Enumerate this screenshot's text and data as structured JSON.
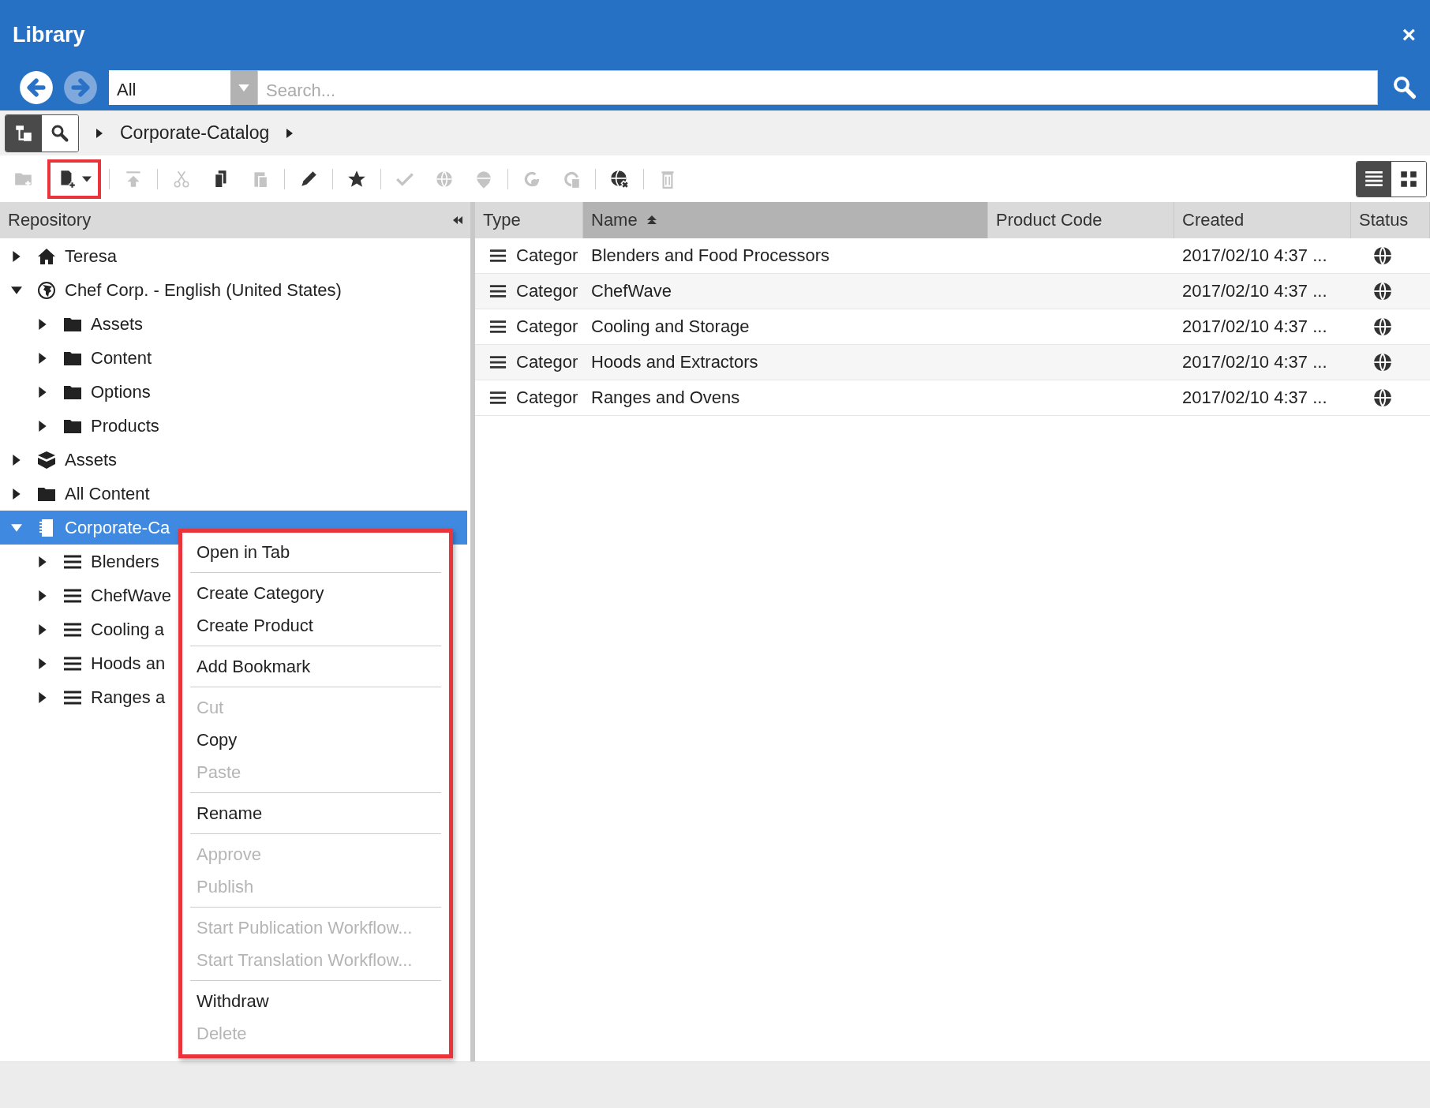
{
  "window": {
    "title": "Library",
    "close": "×"
  },
  "search": {
    "scope": "All",
    "placeholder": "Search..."
  },
  "view_switch": [
    {
      "kind": "tree",
      "selected": true
    },
    {
      "kind": "search",
      "selected": false
    }
  ],
  "breadcrumb": [
    "Corporate-Catalog"
  ],
  "toolbar": [
    {
      "disabled": true,
      "highlighted": false
    },
    {
      "disabled": false,
      "highlighted": true
    },
    {
      "disabled": true,
      "highlighted": false
    },
    {
      "disabled": true,
      "highlighted": false
    },
    {
      "disabled": false,
      "highlighted": false
    },
    {
      "disabled": true,
      "highlighted": false
    },
    {
      "disabled": false,
      "highlighted": false
    },
    {
      "disabled": false,
      "highlighted": false
    },
    {
      "disabled": true,
      "highlighted": false
    },
    {
      "disabled": true,
      "highlighted": false
    },
    {
      "disabled": true,
      "highlighted": false
    },
    {
      "disabled": true,
      "highlighted": false
    },
    {
      "disabled": true,
      "highlighted": false
    },
    {
      "disabled": false,
      "highlighted": false
    },
    {
      "disabled": true,
      "highlighted": false
    }
  ],
  "layout_toggle": [
    {
      "kind": "list",
      "selected": true
    },
    {
      "kind": "grid",
      "selected": false
    }
  ],
  "sidebar": {
    "title": "Repository",
    "items": [
      {
        "label": "Teresa",
        "kind": "home",
        "expanded": false,
        "selected": false
      },
      {
        "label": "Chef Corp. - English (United States)",
        "kind": "site",
        "expanded": true,
        "selected": false,
        "children": [
          {
            "label": "Assets",
            "kind": "folder",
            "expanded": false,
            "selected": false
          },
          {
            "label": "Content",
            "kind": "folder",
            "expanded": false,
            "selected": false
          },
          {
            "label": "Options",
            "kind": "folder",
            "expanded": false,
            "selected": false
          },
          {
            "label": "Products",
            "kind": "folder",
            "expanded": false,
            "selected": false
          }
        ]
      },
      {
        "label": "Assets",
        "kind": "assets",
        "expanded": false,
        "selected": false
      },
      {
        "label": "All Content",
        "kind": "folder",
        "expanded": false,
        "selected": false
      },
      {
        "label": "Corporate-Ca",
        "kind": "catalog",
        "expanded": true,
        "selected": true,
        "children": [
          {
            "label": "Blenders",
            "kind": "category",
            "expanded": false,
            "selected": false
          },
          {
            "label": "ChefWave",
            "kind": "category",
            "expanded": false,
            "selected": false
          },
          {
            "label": "Cooling a",
            "kind": "category",
            "expanded": false,
            "selected": false
          },
          {
            "label": "Hoods an",
            "kind": "category",
            "expanded": false,
            "selected": false
          },
          {
            "label": "Ranges a",
            "kind": "category",
            "expanded": false,
            "selected": false
          }
        ]
      }
    ]
  },
  "table": {
    "columns": [
      {
        "label": "Type",
        "sorted": false
      },
      {
        "label": "Name",
        "sorted": true
      },
      {
        "label": "Product Code",
        "sorted": false
      },
      {
        "label": "Created",
        "sorted": false
      },
      {
        "label": "Status",
        "sorted": false
      }
    ],
    "rows": [
      {
        "type": "Categor",
        "name": "Blenders and Food Processors",
        "product_code": "",
        "created": "2017/02/10 4:37 ..."
      },
      {
        "type": "Categor",
        "name": "ChefWave",
        "product_code": "",
        "created": "2017/02/10 4:37 ..."
      },
      {
        "type": "Categor",
        "name": "Cooling and Storage",
        "product_code": "",
        "created": "2017/02/10 4:37 ..."
      },
      {
        "type": "Categor",
        "name": "Hoods and Extractors",
        "product_code": "",
        "created": "2017/02/10 4:37 ..."
      },
      {
        "type": "Categor",
        "name": "Ranges and Ovens",
        "product_code": "",
        "created": "2017/02/10 4:37 ..."
      }
    ]
  },
  "context_menu": {
    "highlighted": true,
    "groups": [
      [
        {
          "label": "Open in Tab",
          "disabled": false
        }
      ],
      [
        {
          "label": "Create Category",
          "disabled": false
        },
        {
          "label": "Create Product",
          "disabled": false
        }
      ],
      [
        {
          "label": "Add Bookmark",
          "disabled": false
        }
      ],
      [
        {
          "label": "Cut",
          "disabled": true
        },
        {
          "label": "Copy",
          "disabled": false
        },
        {
          "label": "Paste",
          "disabled": true
        }
      ],
      [
        {
          "label": "Rename",
          "disabled": false
        }
      ],
      [
        {
          "label": "Approve",
          "disabled": true
        },
        {
          "label": "Publish",
          "disabled": true
        }
      ],
      [
        {
          "label": "Start Publication Workflow...",
          "disabled": true
        },
        {
          "label": "Start Translation Workflow...",
          "disabled": true
        }
      ],
      [
        {
          "label": "Withdraw",
          "disabled": false
        },
        {
          "label": "Delete",
          "disabled": true
        }
      ]
    ]
  }
}
